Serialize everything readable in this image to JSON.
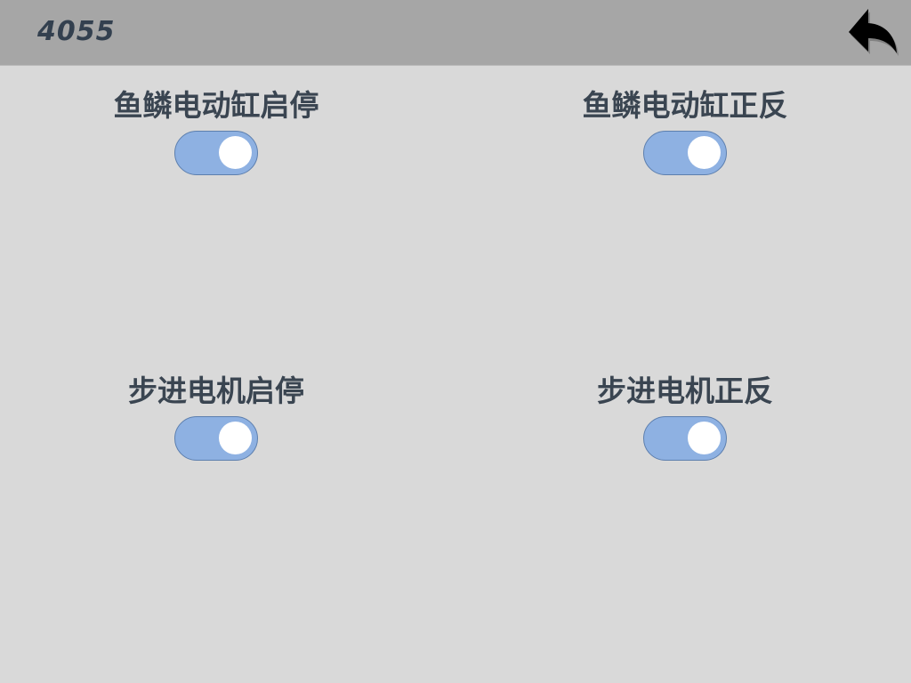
{
  "header": {
    "title": "4055",
    "back_icon": "back-arrow-icon"
  },
  "controls": [
    {
      "label": "鱼鳞电动缸启停",
      "state": "on"
    },
    {
      "label": "鱼鳞电动缸正反",
      "state": "on"
    },
    {
      "label": "步进电机启停",
      "state": "on"
    },
    {
      "label": "步进电机正反",
      "state": "on"
    }
  ],
  "colors": {
    "background": "#d9d9d9",
    "header": "#a6a6a6",
    "text": "#3a4551",
    "toggle_track": "#8eb1e2",
    "toggle_border": "#5d7fae",
    "toggle_knob": "#ffffff"
  }
}
